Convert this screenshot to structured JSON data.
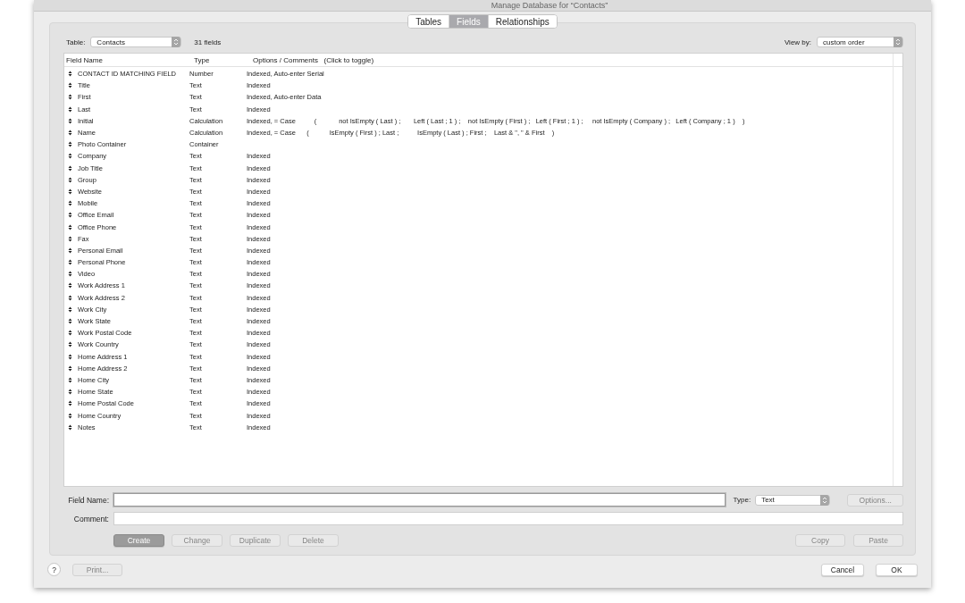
{
  "window": {
    "title": "Manage Database for “Contacts”"
  },
  "tabs": [
    {
      "label": "Tables",
      "selected": false
    },
    {
      "label": "Fields",
      "selected": true
    },
    {
      "label": "Relationships",
      "selected": false
    }
  ],
  "table_picker": {
    "label": "Table:",
    "value": "Contacts"
  },
  "field_count": "31 fields",
  "view_by": {
    "label": "View by:",
    "value": "custom order"
  },
  "table": {
    "columns": [
      "Field Name",
      "Type",
      "Options / Comments   (Click to toggle)"
    ],
    "rows": [
      {
        "name": "CONTACT ID MATCHING FIELD",
        "type": "Number",
        "options": "Indexed, Auto-enter Serial"
      },
      {
        "name": "Title",
        "type": "Text",
        "options": "Indexed"
      },
      {
        "name": "First",
        "type": "Text",
        "options": "Indexed, Auto-enter Data"
      },
      {
        "name": "Last",
        "type": "Text",
        "options": "Indexed"
      },
      {
        "name": "Initial",
        "type": "Calculation",
        "options": "Indexed, = Case          (            not IsEmpty ( Last ) ;       Left ( Last ; 1 ) ;    not IsEmpty ( First ) ;   Left ( First ; 1 ) ;     not IsEmpty ( Company ) ;   Left ( Company ; 1 )    )"
      },
      {
        "name": "Name",
        "type": "Calculation",
        "options": "Indexed, = Case      (           IsEmpty ( First ) ; Last ;          IsEmpty ( Last ) ; First ;    Last & \", \" & First    )"
      },
      {
        "name": "Photo Container",
        "type": "Container",
        "options": ""
      },
      {
        "name": "Company",
        "type": "Text",
        "options": "Indexed"
      },
      {
        "name": "Job Title",
        "type": "Text",
        "options": "Indexed"
      },
      {
        "name": "Group",
        "type": "Text",
        "options": "Indexed"
      },
      {
        "name": "Website",
        "type": "Text",
        "options": "Indexed"
      },
      {
        "name": "Mobile",
        "type": "Text",
        "options": "Indexed"
      },
      {
        "name": "Office Email",
        "type": "Text",
        "options": "Indexed"
      },
      {
        "name": "Office Phone",
        "type": "Text",
        "options": "Indexed"
      },
      {
        "name": "Fax",
        "type": "Text",
        "options": "Indexed"
      },
      {
        "name": "Personal Email",
        "type": "Text",
        "options": "Indexed"
      },
      {
        "name": "Personal Phone",
        "type": "Text",
        "options": "Indexed"
      },
      {
        "name": "Video",
        "type": "Text",
        "options": "Indexed"
      },
      {
        "name": "Work Address 1",
        "type": "Text",
        "options": "Indexed"
      },
      {
        "name": "Work Address 2",
        "type": "Text",
        "options": "Indexed"
      },
      {
        "name": "Work City",
        "type": "Text",
        "options": "Indexed"
      },
      {
        "name": "Work State",
        "type": "Text",
        "options": "Indexed"
      },
      {
        "name": "Work Postal Code",
        "type": "Text",
        "options": "Indexed"
      },
      {
        "name": "Work Country",
        "type": "Text",
        "options": "Indexed"
      },
      {
        "name": "Home Address 1",
        "type": "Text",
        "options": "Indexed"
      },
      {
        "name": "Home Address 2",
        "type": "Text",
        "options": "Indexed"
      },
      {
        "name": "Home City",
        "type": "Text",
        "options": "Indexed"
      },
      {
        "name": "Home State",
        "type": "Text",
        "options": "Indexed"
      },
      {
        "name": "Home Postal Code",
        "type": "Text",
        "options": "Indexed"
      },
      {
        "name": "Home Country",
        "type": "Text",
        "options": "Indexed"
      },
      {
        "name": "Notes",
        "type": "Text",
        "options": "Indexed"
      }
    ]
  },
  "field_name": {
    "label": "Field Name:"
  },
  "type_picker": {
    "label": "Type:",
    "value": "Text"
  },
  "options_button": {
    "label": "Options...",
    "disabled": true
  },
  "comment": {
    "label": "Comment:"
  },
  "edit_buttons": [
    {
      "label": "Create",
      "disabled": false
    },
    {
      "label": "Change",
      "disabled": true
    },
    {
      "label": "Duplicate",
      "disabled": true
    },
    {
      "label": "Delete",
      "disabled": true
    }
  ],
  "clipboard_buttons": [
    {
      "label": "Copy",
      "disabled": true
    },
    {
      "label": "Paste",
      "disabled": true
    }
  ],
  "help": {
    "label": "?"
  },
  "print_button": {
    "label": "Print...",
    "disabled": true
  },
  "dialog_buttons": [
    {
      "label": "Cancel",
      "disabled": false
    },
    {
      "label": "OK",
      "disabled": false
    }
  ]
}
